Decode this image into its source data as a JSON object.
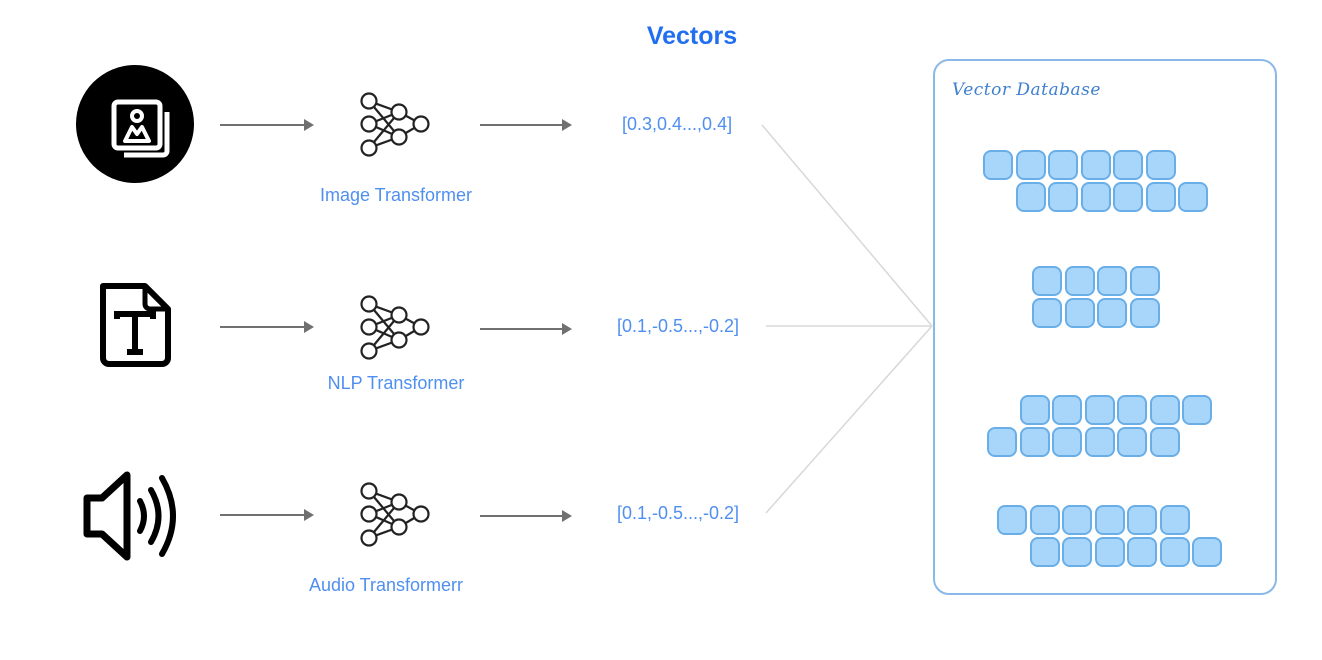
{
  "title": "Vectors",
  "rows": [
    {
      "source_icon": "image-gallery-icon",
      "model_icon": "neural-network-icon",
      "model_label": "Image Transformer",
      "vector": "[0.3,0.4...,0.4]"
    },
    {
      "source_icon": "text-file-icon",
      "model_icon": "neural-network-icon",
      "model_label": "NLP Transformer",
      "vector": "[0.1,-0.5...,-0.2]"
    },
    {
      "source_icon": "speaker-audio-icon",
      "model_icon": "neural-network-icon",
      "model_label": "Audio Transformerr",
      "vector": "[0.1,-0.5...,-0.2]"
    }
  ],
  "database": {
    "title": "Vector Database",
    "groups": [
      {
        "top_row": 6,
        "bottom_row": 6,
        "offset": "bottom-right"
      },
      {
        "top_row": 4,
        "bottom_row": 4,
        "offset": "aligned"
      },
      {
        "top_row": 6,
        "bottom_row": 6,
        "offset": "top-right"
      },
      {
        "top_row": 6,
        "bottom_row": 6,
        "offset": "bottom-right"
      }
    ]
  },
  "colors": {
    "title": "#1f6ff0",
    "label": "#4f8ff0",
    "cell_fill": "#a8d6fb",
    "cell_border": "#6aaee8",
    "db_border": "#8ab8e8",
    "arrow": "#707070",
    "connector": "#d8d8d8"
  }
}
